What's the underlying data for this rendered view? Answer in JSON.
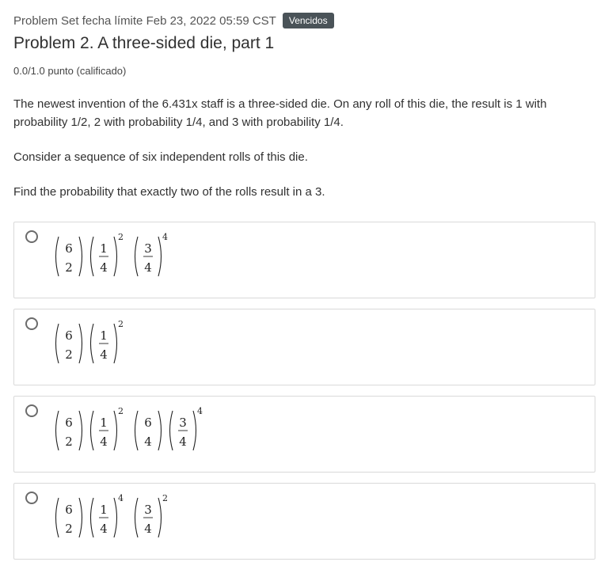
{
  "header": {
    "meta": "Problem Set fecha límite Feb 23, 2022 05:59 CST",
    "badge": "Vencidos",
    "title": "Problem 2. A three-sided die, part 1",
    "score": "0.0/1.0 punto (calificado)"
  },
  "prompt": {
    "p1": "The newest invention of the 6.431x staff is a three-sided die. On any roll of this die, the result is 1 with probability 1/2, 2 with probability 1/4, and 3 with probability 1/4.",
    "p2": "Consider a sequence of six independent rolls of this die.",
    "p3": "Find the probability that exactly two of the rolls result in a 3."
  },
  "choices": [
    {
      "factors": [
        {
          "type": "binom",
          "top": "6",
          "bottom": "2"
        },
        {
          "type": "frac",
          "num": "1",
          "den": "4",
          "exp": "2"
        },
        {
          "type": "frac",
          "num": "3",
          "den": "4",
          "exp": "4"
        }
      ]
    },
    {
      "factors": [
        {
          "type": "binom",
          "top": "6",
          "bottom": "2"
        },
        {
          "type": "frac",
          "num": "1",
          "den": "4",
          "exp": "2"
        }
      ]
    },
    {
      "factors": [
        {
          "type": "binom",
          "top": "6",
          "bottom": "2"
        },
        {
          "type": "frac",
          "num": "1",
          "den": "4",
          "exp": "2"
        },
        {
          "type": "binom",
          "top": "6",
          "bottom": "4"
        },
        {
          "type": "frac",
          "num": "3",
          "den": "4",
          "exp": "4"
        }
      ]
    },
    {
      "factors": [
        {
          "type": "binom",
          "top": "6",
          "bottom": "2"
        },
        {
          "type": "frac",
          "num": "1",
          "den": "4",
          "exp": "4"
        },
        {
          "type": "frac",
          "num": "3",
          "den": "4",
          "exp": "2"
        }
      ]
    }
  ]
}
